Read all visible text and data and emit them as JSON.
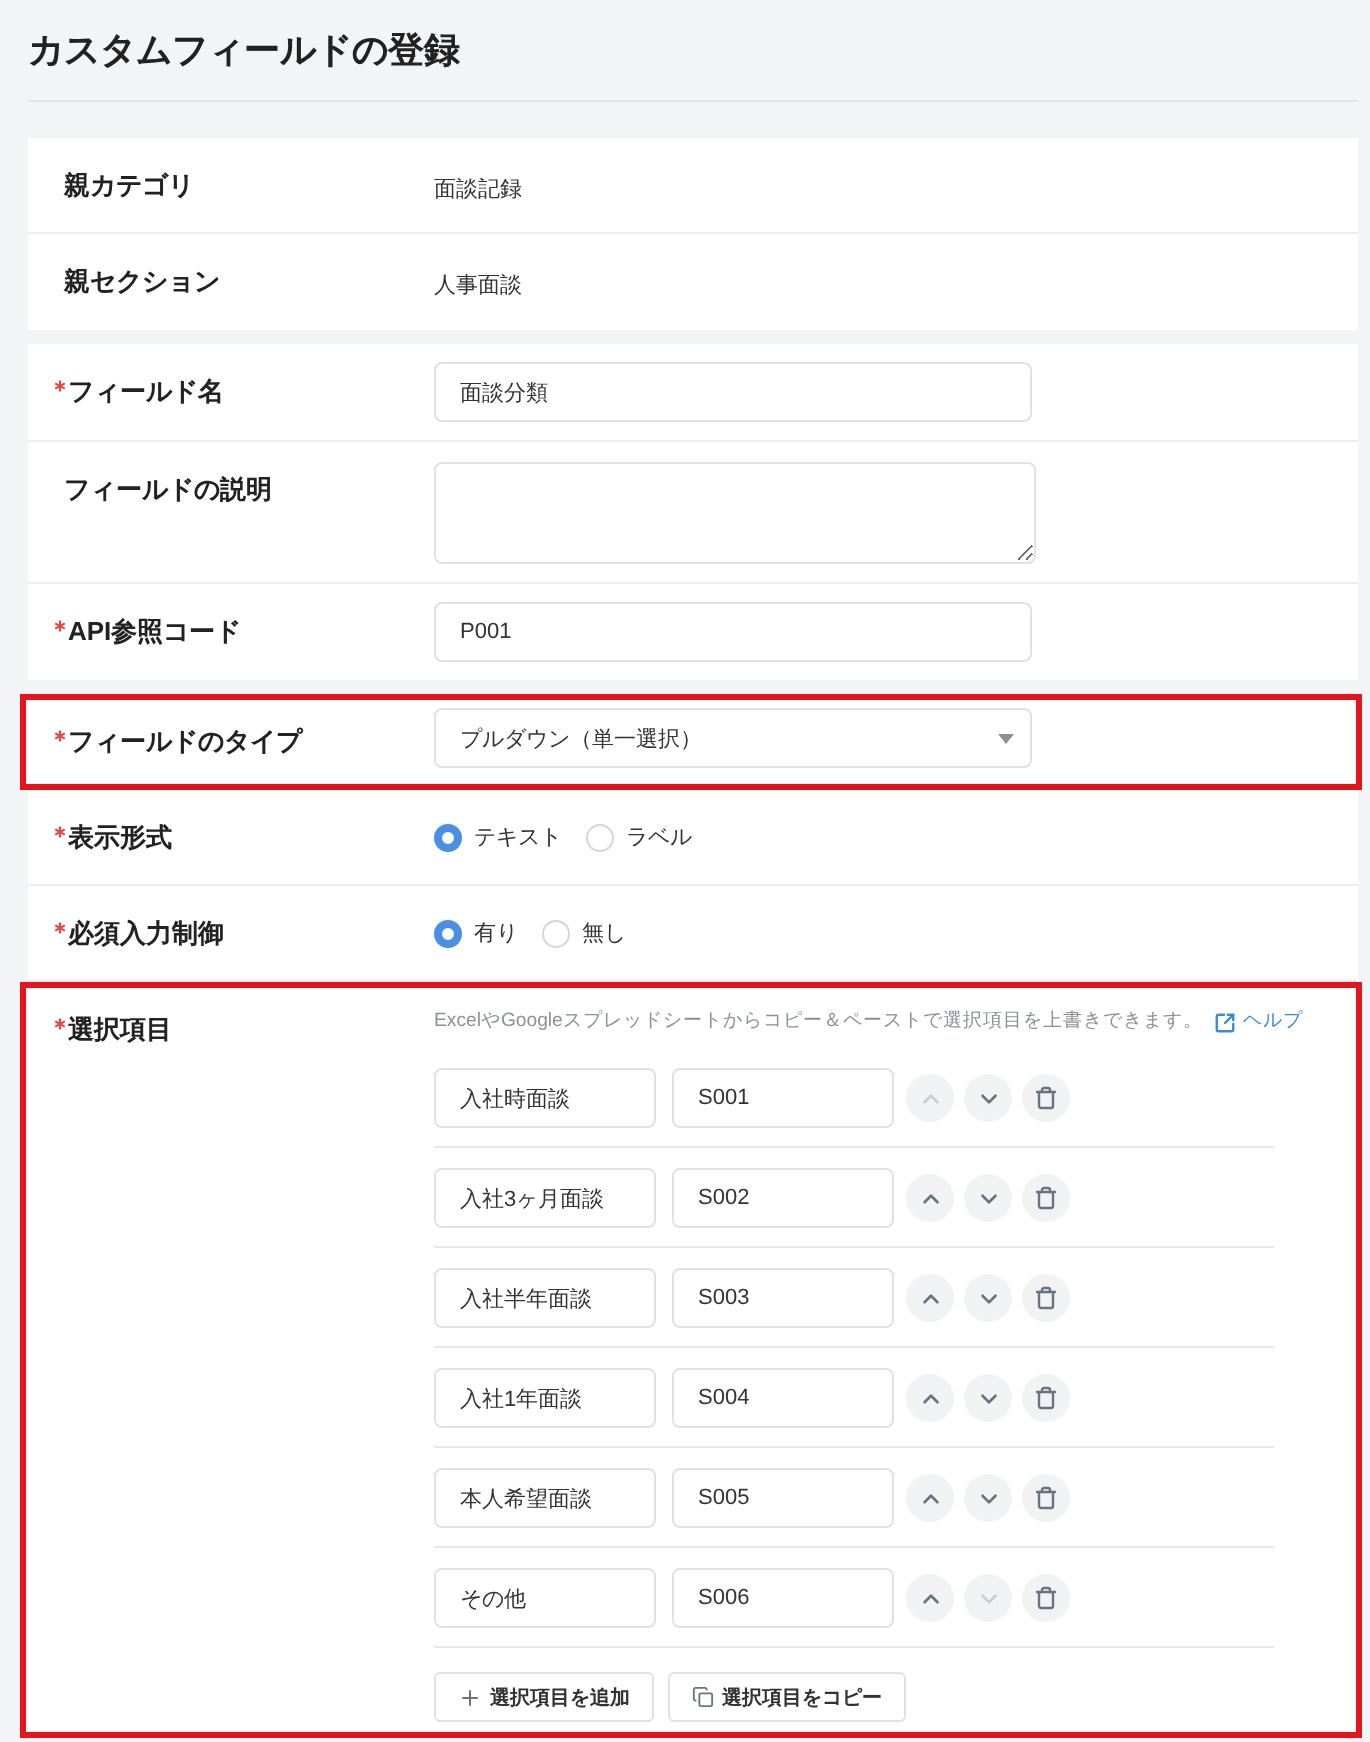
{
  "page": {
    "title": "カスタムフィールドの登録"
  },
  "parent_info": [
    {
      "label": "親カテゴリ",
      "value": "面談記録"
    },
    {
      "label": "親セクション",
      "value": "人事面談"
    }
  ],
  "basic_fields": [
    {
      "kind": "input",
      "label": "フィールド名",
      "required": true,
      "value": "面談分類"
    },
    {
      "kind": "textarea",
      "label": "フィールドの説明",
      "required": false
    },
    {
      "kind": "input",
      "label": "API参照コード",
      "required": true,
      "value": "P001"
    }
  ],
  "settings": [
    {
      "kind": "select",
      "label": "フィールドのタイプ",
      "required": true,
      "highlighted": true,
      "value": "プルダウン（単一選択）"
    },
    {
      "kind": "radio",
      "label": "表示形式",
      "required": true,
      "highlighted": false,
      "options": [
        {
          "label": "テキスト",
          "selected": true
        },
        {
          "label": "ラベル",
          "selected": false
        }
      ]
    },
    {
      "kind": "radio",
      "label": "必須入力制御",
      "required": true,
      "highlighted": false,
      "options": [
        {
          "label": "有り",
          "selected": true
        },
        {
          "label": "無し",
          "selected": false
        }
      ]
    },
    {
      "kind": "choices",
      "label": "選択項目",
      "required": true,
      "highlighted": true,
      "hint": "ExcelやGoogleスプレッドシートからコピー＆ペーストで選択項目を上書きできます。",
      "help_link": "ヘルプ",
      "items": [
        {
          "label": "入社時面談",
          "code": "S001",
          "up_disabled": true,
          "down_disabled": false
        },
        {
          "label": "入社3ヶ月面談",
          "code": "S002",
          "up_disabled": false,
          "down_disabled": false
        },
        {
          "label": "入社半年面談",
          "code": "S003",
          "up_disabled": false,
          "down_disabled": false
        },
        {
          "label": "入社1年面談",
          "code": "S004",
          "up_disabled": false,
          "down_disabled": false
        },
        {
          "label": "本人希望面談",
          "code": "S005",
          "up_disabled": false,
          "down_disabled": false
        },
        {
          "label": "その他",
          "code": "S006",
          "up_disabled": false,
          "down_disabled": true
        }
      ],
      "actions": [
        {
          "kind": "add",
          "label": "選択項目を追加"
        },
        {
          "kind": "copy",
          "label": "選択項目をコピー"
        }
      ]
    }
  ]
}
